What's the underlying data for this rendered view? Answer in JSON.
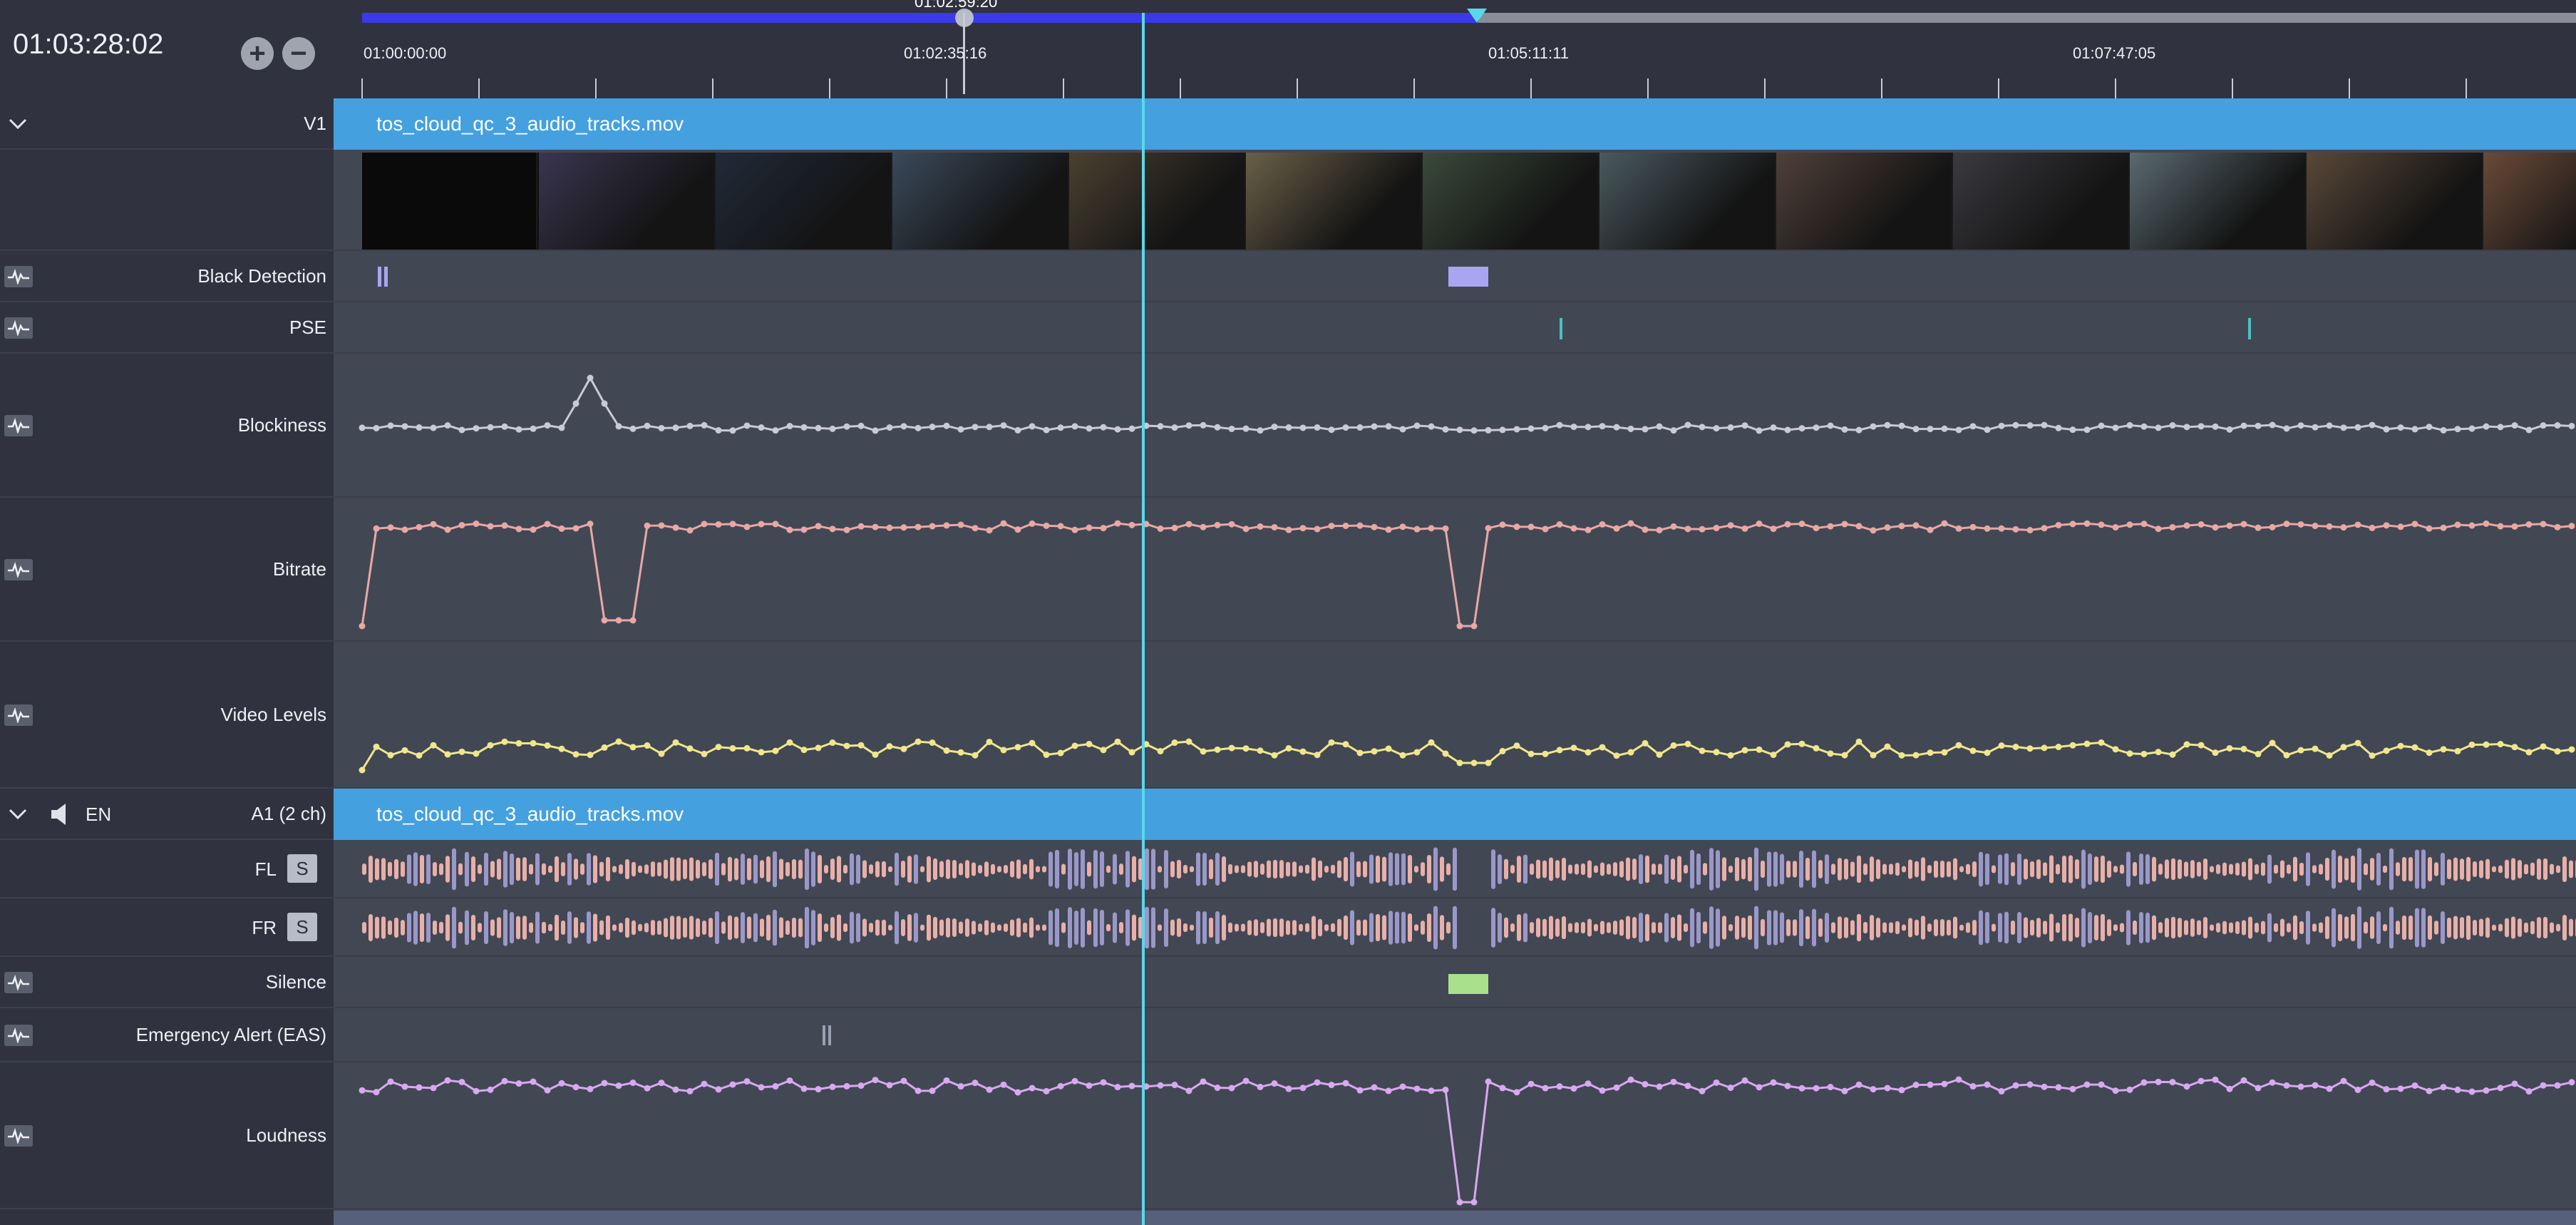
{
  "timecode": "01:03:28:02",
  "zoom": {
    "in_label": "+",
    "out_label": "−"
  },
  "ruler": {
    "playhead_timecode": "01:02:59:20",
    "labels": [
      "01:00:00:00",
      "01:02:35:16",
      "01:05:11:11",
      "01:07:47:05"
    ]
  },
  "video_track": {
    "id": "V1",
    "clip_name": "tos_cloud_qc_3_audio_tracks.mov",
    "analysis_tracks": [
      "Black Detection",
      "PSE",
      "Blockiness",
      "Bitrate",
      "Video Levels"
    ]
  },
  "audio_track": {
    "language": "EN",
    "id": "A1 (2 ch)",
    "clip_name": "tos_cloud_qc_3_audio_tracks.mov",
    "channels": [
      {
        "name": "FL",
        "solo_label": "S"
      },
      {
        "name": "FR",
        "solo_label": "S"
      }
    ],
    "analysis_tracks": [
      "Silence",
      "Emergency Alert (EAS)",
      "Loudness"
    ]
  },
  "colors": {
    "clip": "#45a0e0",
    "playhead": "#5ad8ea",
    "blockiness": "#c8cce0",
    "bitrate": "#e8a8a4",
    "video_levels": "#f0e68c",
    "loudness": "#d8a8f0",
    "black_detection": "#a8a6f0",
    "pse": "#4ec0c0",
    "silence": "#a8e08c",
    "waveform": "#e8b0a8"
  },
  "icons": [
    "chevron-down-icon",
    "waveform-icon",
    "speaker-icon",
    "plus-icon",
    "minus-icon"
  ]
}
